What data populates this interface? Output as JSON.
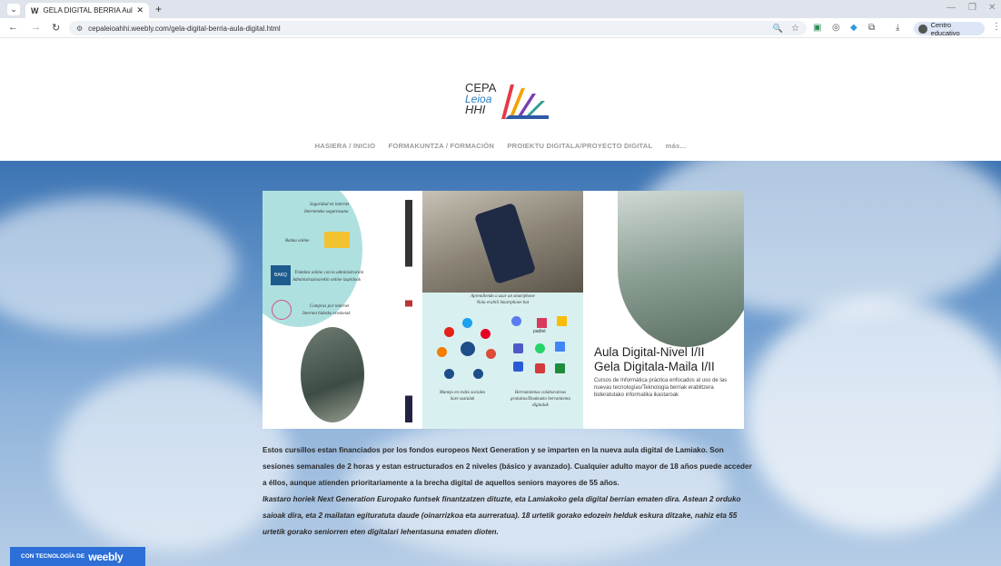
{
  "browser": {
    "tab_title": "GELA DIGITAL BERRIA Aula Dig",
    "url": "cepaleioahhi.weebly.com/gela-digital-berria-aula-digital.html",
    "profile_label": "Centro educativo"
  },
  "site": {
    "logo": {
      "line1": "CEPA",
      "line2": "Leioa",
      "line3": "HHI"
    },
    "nav": [
      {
        "label": "HASIERA / INICIO"
      },
      {
        "label": "FORMAKUNTZA / FORMACIÓN"
      },
      {
        "label": "PROIEKTU DIGITALA/PROYECTO DIGITAL"
      },
      {
        "label": "más..."
      }
    ],
    "poster": {
      "left": {
        "item1a": "Seguridad en internet",
        "item1b": "Interneteko segurtasuna",
        "item2": "Banka online",
        "item3a": "Trámites online con la administración",
        "item3b": "Administrazioarekin online izapidoak",
        "item4a": "Compras por internet",
        "item4b": "Internet bidezko erosketak",
        "bak": "BAKQ"
      },
      "middle": {
        "caption1": "Aprendiendo a usar un smartphone",
        "caption2": "Nola erabili Smartphone bat",
        "social1": "Manejo en redes sociales",
        "social2": "Sare sozialak",
        "collab1": "Herramientas colaborativas",
        "collab2": "gratuitas/Doakoako herramienta",
        "collab3": "digitalak",
        "padlet": "padlet"
      },
      "right": {
        "title1": "Aula Digital-Nivel I/II",
        "title2": "Gela Digitala-Maila I/II",
        "sub": "Cursos de Informática práctica enfocados al uso de las nuevas tecnologías/Teknologia berriak erabiltzera bideratutako informatika ikastaroak"
      }
    },
    "text": {
      "es": "Estos cursillos estan financiados por los fondos europeos Next Generation y se imparten en la nueva aula digital de Lamiako. Son sesiones semanales de 2 horas y estan estructurados en 2 niveles (básico y avanzado). Cualquier adulto mayor de 18 años puede acceder a éllos, aunque atienden prioritariamente a la brecha digital de aquellos seniors mayores de 55 años.",
      "eu": "Ikastaro horiek Next Generation Europako funtsek finantzatzen dituzte, eta Lamiakoko gela digital berrian ematen dira. Astean 2 orduko saioak dira, eta 2 mailatan egituratuta daude (oinarrizkoa eta aurreratua). 18 urtetik gorako edozein helduk eskura ditzake, nahiz eta 55 urtetik gorako seniorren eten digitalari lehentasuna ematen dioten."
    },
    "badge": {
      "prefix": "CON TECNOLOGÍA DE",
      "brand": "weebly"
    }
  }
}
